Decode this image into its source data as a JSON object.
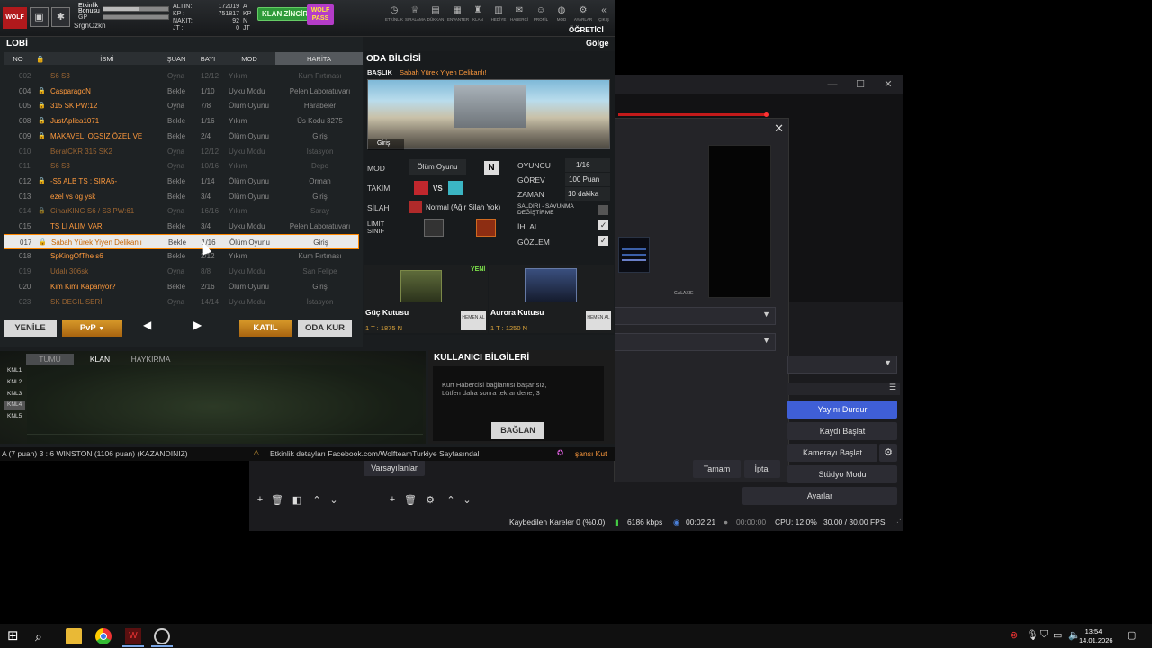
{
  "obs": {
    "dropdown_chevron": "▼",
    "defaults_button": "Varsayılanlar",
    "ok_button": "Tamam",
    "cancel_button": "İptal",
    "controls": [
      "Yayını Durdur",
      "Kaydı Başlat",
      "Kamerayı Başlat",
      "Stüdyo Modu",
      "Ayarlar"
    ],
    "status": {
      "dropped_frames": "Kaybedilen Kareler 0 (%0.0)",
      "bitrate": "6186 kbps",
      "stream_time": "00:02:21",
      "record_time": "00:00:00",
      "cpu": "CPU: 12.0%",
      "fps": "30.00 / 30.00 FPS"
    },
    "mini_preview_label": "GALAXIE"
  },
  "game": {
    "logo": "WOLF",
    "event_badge": [
      "Etkinlik",
      "Bonusu"
    ],
    "gp_label": "GP",
    "username": "SrgnOzkn",
    "currency": [
      {
        "label": "ALTIN:",
        "value": "172019",
        "unit": "A"
      },
      {
        "label": "KP :",
        "value": "751817",
        "unit": "KP"
      },
      {
        "label": "NAKIT:",
        "value": "92",
        "unit": "N"
      },
      {
        "label": "JT :",
        "value": "0",
        "unit": "JT"
      }
    ],
    "clan_chain": "KLAN ZİNCİRİ",
    "wolf_pass": "WOLF PASS",
    "nav": [
      "ETKİNLİK",
      "SIRALAMA",
      "DÜKKAN",
      "ENVANTER",
      "KLAN",
      "HEDİYE",
      "HABERCİ",
      "PROFİL",
      "MOD",
      "AYARLAR",
      "ÇIKIŞ"
    ],
    "tutorial": "ÖĞRETİCİ",
    "lobby": {
      "title": "LOBİ",
      "view": "Gölge",
      "columns": [
        "NO",
        "İSMİ",
        "ŞUAN",
        "BAYI",
        "MOD",
        "HARİTA"
      ],
      "rows": [
        {
          "no": "002",
          "locked": false,
          "name": "S6 S3",
          "state": "Oyna",
          "players": "12/12",
          "mode": "Yıkım",
          "map": "Kum Fırtınası",
          "dim": true
        },
        {
          "no": "004",
          "locked": true,
          "name": "CasparagoN",
          "state": "Bekle",
          "players": "1/10",
          "mode": "Uyku Modu",
          "map": "Pelen Laboratuvarı",
          "dim": false
        },
        {
          "no": "005",
          "locked": true,
          "name": "315 SK PW:12",
          "state": "Oyna",
          "players": "7/8",
          "mode": "Ölüm Oyunu",
          "map": "Harabeler",
          "dim": false
        },
        {
          "no": "008",
          "locked": true,
          "name": "JustAplica1071",
          "state": "Bekle",
          "players": "1/16",
          "mode": "Yıkım",
          "map": "Üs Kodu 3275",
          "dim": false
        },
        {
          "no": "009",
          "locked": true,
          "name": "MAKAVELİ OGSIZ ÖZEL VE",
          "state": "Bekle",
          "players": "2/4",
          "mode": "Ölüm Oyunu",
          "map": "Giriş",
          "dim": false
        },
        {
          "no": "010",
          "locked": false,
          "name": "BeratCKR 315 SK2",
          "state": "Oyna",
          "players": "12/12",
          "mode": "Uyku Modu",
          "map": "İstasyon",
          "dim": true
        },
        {
          "no": "011",
          "locked": false,
          "name": "S6 S3",
          "state": "Oyna",
          "players": "10/16",
          "mode": "Yıkım",
          "map": "Depo",
          "dim": true
        },
        {
          "no": "012",
          "locked": true,
          "name": "-S5 ALB TS : SIRA5-",
          "state": "Bekle",
          "players": "1/14",
          "mode": "Ölüm Oyunu",
          "map": "Orman",
          "dim": false
        },
        {
          "no": "013",
          "locked": false,
          "name": "ezel vs og ysk",
          "state": "Bekle",
          "players": "3/4",
          "mode": "Ölüm Oyunu",
          "map": "Giriş",
          "dim": false
        },
        {
          "no": "014",
          "locked": true,
          "name": "CinarKING S6 / S3 PW:61",
          "state": "Oyna",
          "players": "16/16",
          "mode": "Yıkım",
          "map": "Saray",
          "dim": true
        },
        {
          "no": "015",
          "locked": false,
          "name": "TS LI ALIM VAR",
          "state": "Bekle",
          "players": "3/4",
          "mode": "Uyku Modu",
          "map": "Pelen Laboratuvarı",
          "dim": false
        },
        {
          "no": "017",
          "locked": true,
          "name": "Sabah Yürek Yiyen Delikanlı",
          "state": "Bekle",
          "players": "1/16",
          "mode": "Ölüm Oyunu",
          "map": "Giriş",
          "dim": false,
          "selected": true
        },
        {
          "no": "018",
          "locked": false,
          "name": "SpKingOfThe s6",
          "state": "Bekle",
          "players": "2/12",
          "mode": "Yıkım",
          "map": "Kum Fırtınası",
          "dim": false
        },
        {
          "no": "019",
          "locked": false,
          "name": "Udalı 306sk",
          "state": "Oyna",
          "players": "8/8",
          "mode": "Uyku Modu",
          "map": "San Felipe",
          "dim": true
        },
        {
          "no": "020",
          "locked": false,
          "name": "Kim Kimi Kapanyor?",
          "state": "Bekle",
          "players": "2/16",
          "mode": "Ölüm Oyunu",
          "map": "Giriş",
          "dim": false
        },
        {
          "no": "023",
          "locked": false,
          "name": "SK DEGIL SERİ",
          "state": "Oyna",
          "players": "14/14",
          "mode": "Uyku Modu",
          "map": "İstasyon",
          "dim": true
        }
      ],
      "refresh": "YENİLE",
      "pvp": "PvP",
      "join": "KATIL",
      "create_room": "ODA KUR"
    },
    "room": {
      "title": "ODA BİLGİSİ",
      "heading_label": "BAŞLIK",
      "heading_value": "Sabah Yürek Yiyen Delikanlı!",
      "map": "Giriş",
      "mode_label": "MOD",
      "mode_value": "Ölüm Oyunu",
      "mode_badge": "N",
      "team_label": "TAKIM",
      "vs": "VS",
      "weapon_label": "SİLAH",
      "weapon_value": "Normal (Ağır Silah Yok)",
      "limit_label": "LİMİT SINIF",
      "players_label": "OYUNCU",
      "players_value": "1/16",
      "mission_label": "GÖREV",
      "mission_value": "100 Puan",
      "time_label": "ZAMAN",
      "time_value": "10 dakika",
      "attack_defense_label": "SALDIRI - SAVUNMA DEĞİŞTİRME",
      "violation_label": "İHLAL",
      "violation_checked": true,
      "spectate_label": "GÖZLEM",
      "spectate_checked": true
    },
    "boxes": [
      {
        "name": "Güç Kutusu",
        "price": "1 T : 1875 N",
        "new": "YENİ",
        "buy": "HEMEN AL",
        "number": "1"
      },
      {
        "name": "Aurora Kutusu",
        "price": "1 T : 1250 N",
        "buy": "HEMEN AL",
        "number": "2"
      }
    ],
    "chat": {
      "tabs": [
        "TÜMÜ",
        "KLAN",
        "HAYKIRMA"
      ],
      "channels": [
        "KNL1",
        "KNL2",
        "KNL3",
        "KNL4",
        "KNL5"
      ]
    },
    "user_info": {
      "title": "KULLANICI BİLGİLERİ",
      "message_line1": "Kurt Habercisi bağlantısı başarısız,",
      "message_line2": "Lütfen daha sonra tekrar dene, 3",
      "connect": "BAĞLAN"
    },
    "ticker": {
      "left": "A (7 puan) 3 : 6 WINSTON (1106 puan) (KAZANDINIZ)",
      "middle": "Etkinlik detayları Facebook.com/WolfteamTurkiye Sayfasındal",
      "right": "şansı Kut"
    }
  },
  "taskbar": {
    "time": "13:54",
    "date": "14.01.2026"
  }
}
